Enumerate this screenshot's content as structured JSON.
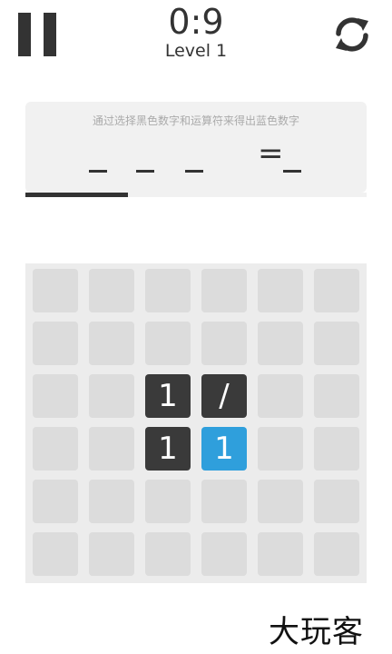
{
  "header": {
    "timer": "0:9",
    "level": "Level 1",
    "pause_icon": "pause-icon",
    "restart_icon": "restart-icon"
  },
  "puzzle": {
    "instruction": "通过选择黑色数字和运算符来得出蓝色数字",
    "equals": "=",
    "progress_fraction": 0.3
  },
  "board": {
    "rows": 6,
    "cols": 6,
    "tiles": [
      {
        "row": 2,
        "col": 2,
        "text": "1",
        "kind": "dark"
      },
      {
        "row": 2,
        "col": 3,
        "text": "/",
        "kind": "dark"
      },
      {
        "row": 3,
        "col": 2,
        "text": "1",
        "kind": "dark"
      },
      {
        "row": 3,
        "col": 3,
        "text": "1",
        "kind": "blue"
      }
    ]
  },
  "watermark": "大玩客",
  "colors": {
    "dark_tile": "#3a3a3a",
    "target_tile": "#2f9fdc",
    "empty_tile": "#dcdcdc",
    "board_bg": "#ececec"
  }
}
